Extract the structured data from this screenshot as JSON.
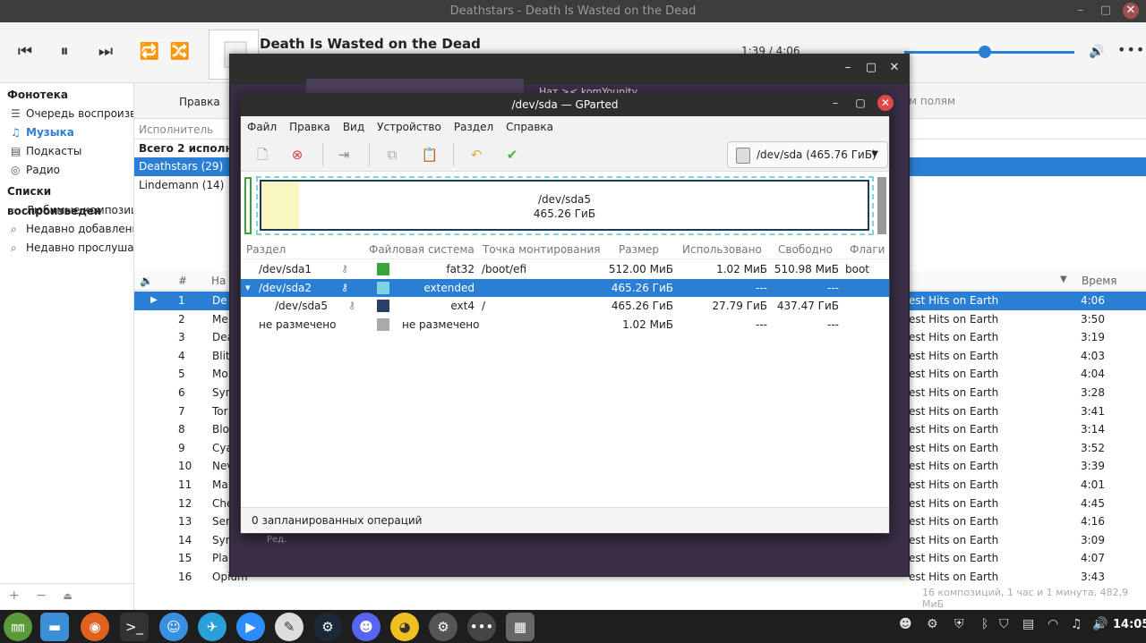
{
  "player": {
    "window_title": "Deathstars - Death Is Wasted on the Dead",
    "track_title": "Death Is Wasted on the Dead",
    "time": "1:39 / 4:06",
    "progress": 0.4
  },
  "sidebar": {
    "library_heading": "Фонотека",
    "library_items": [
      {
        "label": "Очередь воспроизв.",
        "icon": "queue-icon"
      },
      {
        "label": "Музыка",
        "icon": "music-note-icon"
      },
      {
        "label": "Подкасты",
        "icon": "podcast-icon"
      },
      {
        "label": "Радио",
        "icon": "radio-icon"
      }
    ],
    "playlists_heading": "Списки воспроизведен",
    "playlist_items": [
      {
        "label": "Любимые композиц",
        "icon": "search-icon"
      },
      {
        "label": "Недавно добавленн",
        "icon": "search-icon"
      },
      {
        "label": "Недавно прослушан",
        "icon": "search-icon"
      }
    ],
    "footer_add": "+",
    "footer_remove": "−",
    "footer_eject": "⏏"
  },
  "browser": {
    "edit_label": "Правка",
    "fields_label": "м полям",
    "artist_column": "Исполнитель",
    "artists": [
      {
        "label": "Всего 2 исполнит",
        "bold": true,
        "selected": false
      },
      {
        "label": "Deathstars (29)",
        "bold": false,
        "selected": true
      },
      {
        "label": "Lindemann (14)",
        "bold": false,
        "selected": false
      }
    ],
    "tracks_header": {
      "num": "#",
      "title": "На",
      "time": "Время"
    },
    "tracks": [
      {
        "num": "1",
        "title": "De",
        "album": "est Hits on Earth",
        "time": "4:06",
        "playing": true
      },
      {
        "num": "2",
        "title": "Me",
        "album": "est Hits on Earth",
        "time": "3:50"
      },
      {
        "num": "3",
        "title": "Dea",
        "album": "est Hits on Earth",
        "time": "3:19"
      },
      {
        "num": "4",
        "title": "Blit",
        "album": "est Hits on Earth",
        "time": "4:03"
      },
      {
        "num": "5",
        "title": "Mo",
        "album": "est Hits on Earth",
        "time": "4:04"
      },
      {
        "num": "6",
        "title": "Syn",
        "album": "est Hits on Earth",
        "time": "3:28"
      },
      {
        "num": "7",
        "title": "Tor",
        "album": "est Hits on Earth",
        "time": "3:41"
      },
      {
        "num": "8",
        "title": "Blo",
        "album": "est Hits on Earth",
        "time": "3:14"
      },
      {
        "num": "9",
        "title": "Cya",
        "album": "est Hits on Earth",
        "time": "3:52"
      },
      {
        "num": "10",
        "title": "Nev",
        "album": "est Hits on Earth",
        "time": "3:39"
      },
      {
        "num": "11",
        "title": "Ma",
        "album": "est Hits on Earth",
        "time": "4:01"
      },
      {
        "num": "12",
        "title": "Che",
        "album": "est Hits on Earth",
        "time": "4:45"
      },
      {
        "num": "13",
        "title": "Sen",
        "album": "est Hits on Earth",
        "time": "4:16"
      },
      {
        "num": "14",
        "title": "Syn",
        "album": "est Hits on Earth",
        "time": "3:09"
      },
      {
        "num": "15",
        "title": "Pla",
        "album": "est Hits on Earth",
        "time": "4:07"
      },
      {
        "num": "16",
        "title": "Opium",
        "album": "est Hits on Earth",
        "time": "3:43"
      }
    ],
    "status": "16 композиций, 1 час и 1 минута, 482,9 МиБ"
  },
  "bg_window": {
    "text": "Нат >< komYounity",
    "label": "Ред."
  },
  "gparted": {
    "title": "/dev/sda — GParted",
    "menu": [
      "Файл",
      "Правка",
      "Вид",
      "Устройство",
      "Раздел",
      "Справка"
    ],
    "device": "/dev/sda (465.76 ГиБ)",
    "map_label": "/dev/sda5",
    "map_size": "465.26 ГиБ",
    "columns": {
      "partition": "Раздел",
      "fs": "Файловая система",
      "mount": "Точка монтирования",
      "size": "Размер",
      "used": "Использовано",
      "free": "Свободно",
      "flags": "Флаги"
    },
    "rows": [
      {
        "partition": "/dev/sda1",
        "fs": "fat32",
        "mount": "/boot/efi",
        "size": "512.00 МиБ",
        "used": "1.02 МиБ",
        "free": "510.98 МиБ",
        "flags": "boot",
        "color": "#3aa43a",
        "key": true,
        "indent": 0
      },
      {
        "partition": "/dev/sda2",
        "fs": "extended",
        "mount": "",
        "size": "465.26 ГиБ",
        "used": "---",
        "free": "---",
        "flags": "",
        "color": "#7fd4e4",
        "key": true,
        "indent": 0,
        "selected": true,
        "expander": "▾"
      },
      {
        "partition": "/dev/sda5",
        "fs": "ext4",
        "mount": "/",
        "size": "465.26 ГиБ",
        "used": "27.79 ГиБ",
        "free": "437.47 ГиБ",
        "flags": "",
        "color": "#2a3f66",
        "key": true,
        "indent": 1
      },
      {
        "partition": "не размечено",
        "fs": "не размечено",
        "mount": "",
        "size": "1.02 МиБ",
        "used": "---",
        "free": "---",
        "flags": "",
        "color": "#aaaaaa",
        "key": false,
        "indent": 0
      }
    ],
    "status": "0 запланированных операций"
  },
  "taskbar": {
    "clock": "14:05"
  }
}
